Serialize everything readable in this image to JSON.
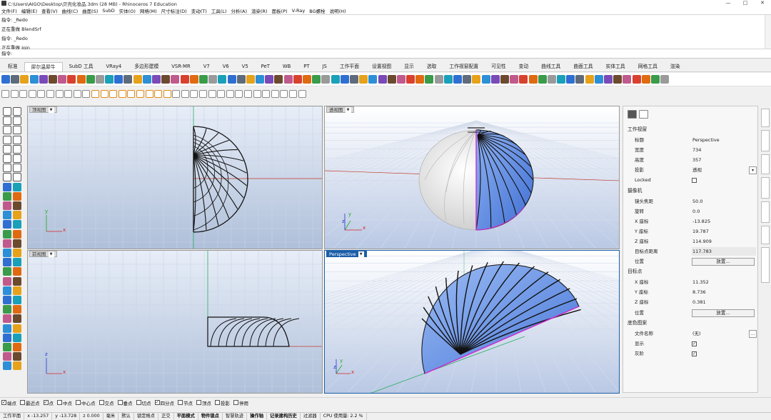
{
  "window": {
    "title": "C:\\Users\\AIGO\\Desktop\\贝壳化妆品.3dm (28 MB) - Rhinoceros 7 Education",
    "min": "—",
    "max": "□",
    "close": "✕"
  },
  "menu": [
    "文件(F)",
    "编辑(E)",
    "查看(V)",
    "曲线(C)",
    "曲面(S)",
    "SubD",
    "实体(O)",
    "网格(M)",
    "尺寸标注(D)",
    "变动(T)",
    "工具(L)",
    "分析(A)",
    "渲染(R)",
    "面板(P)",
    "V-Ray",
    "BG螺栓",
    "说明(H)"
  ],
  "command_history": [
    "指令: _Redo",
    "正在重做 BlendSrf",
    "指令: _Redo",
    "正在重做 Join"
  ],
  "command_prompt": "指令:",
  "toolbar_tabs": [
    "标准",
    "犀尔温犀牛",
    "SubD 工具",
    "VRay4",
    "多边形建模",
    "VSR-MR",
    "V7",
    "V6",
    "V5",
    "PeT",
    "WB",
    "PT",
    "JS",
    "工作平面",
    "设置视图",
    "显示",
    "选取",
    "工作视窗配置",
    "可见性",
    "变动",
    "曲线工具",
    "曲面工具",
    "实体工具",
    "网格工具",
    "渲染"
  ],
  "active_tab_index": 1,
  "viewports": {
    "top": {
      "label": "顶视图"
    },
    "persp_top": {
      "label": "透视图"
    },
    "front": {
      "label": "前视图"
    },
    "perspective": {
      "label": "Perspective"
    }
  },
  "axes": {
    "x": "x",
    "y": "y",
    "z": "z"
  },
  "panel": {
    "section_viewport": "工作视窗",
    "rows_viewport": [
      {
        "k": "标题",
        "v": "Perspective"
      },
      {
        "k": "宽度",
        "v": "734"
      },
      {
        "k": "高度",
        "v": "357"
      },
      {
        "k": "投影",
        "v": "透视"
      },
      {
        "k": "Locked",
        "v": ""
      }
    ],
    "section_camera": "摄像机",
    "rows_camera": [
      {
        "k": "镜头焦距",
        "v": "50.0"
      },
      {
        "k": "旋转",
        "v": "0.0"
      },
      {
        "k": "X 座标",
        "v": "-13.825"
      },
      {
        "k": "Y 座标",
        "v": "19.787"
      },
      {
        "k": "Z 座标",
        "v": "114.909"
      },
      {
        "k": "目标点距离",
        "v": "117.783"
      },
      {
        "k": "位置",
        "v": "放置..."
      }
    ],
    "section_target": "目标点",
    "rows_target": [
      {
        "k": "X 座标",
        "v": "11.352"
      },
      {
        "k": "Y 座标",
        "v": "8.736"
      },
      {
        "k": "Z 座标",
        "v": "0.381"
      },
      {
        "k": "位置",
        "v": "放置..."
      }
    ],
    "section_wallpaper": "底色图案",
    "rows_wallpaper": [
      {
        "k": "文件名称",
        "v": "(无)"
      },
      {
        "k": "显示",
        "v": "✓"
      },
      {
        "k": "灰阶",
        "v": "✓"
      }
    ]
  },
  "osnaps": [
    {
      "label": "端点",
      "checked": true
    },
    {
      "label": "最近点",
      "checked": false
    },
    {
      "label": "点",
      "checked": true
    },
    {
      "label": "中点",
      "checked": false
    },
    {
      "label": "中心点",
      "checked": false
    },
    {
      "label": "交点",
      "checked": false
    },
    {
      "label": "垂点",
      "checked": false
    },
    {
      "label": "切点",
      "checked": false
    },
    {
      "label": "四分点",
      "checked": true
    },
    {
      "label": "节点",
      "checked": false
    },
    {
      "label": "顶点",
      "checked": false
    },
    {
      "label": "投影",
      "checked": false
    },
    {
      "label": "停用",
      "checked": false
    }
  ],
  "status": [
    "工作平面",
    "x -13.257",
    "y -13.728",
    "z 0.000",
    "毫米",
    "默认",
    "锁定格点",
    "正交",
    "平面模式",
    "物件锁点",
    "智慧轨迹",
    "操作轴",
    "记录建构历史",
    "过滤器",
    "CPU 使用量: 2.2 %"
  ],
  "status_bold": [
    8,
    9,
    11,
    12
  ],
  "colors": {
    "accent": "#1c5ea8",
    "surface": "#6a92e6",
    "edge_select": "#d22bd2",
    "x_axis": "#c0392b",
    "y_axis": "#27ae60"
  }
}
